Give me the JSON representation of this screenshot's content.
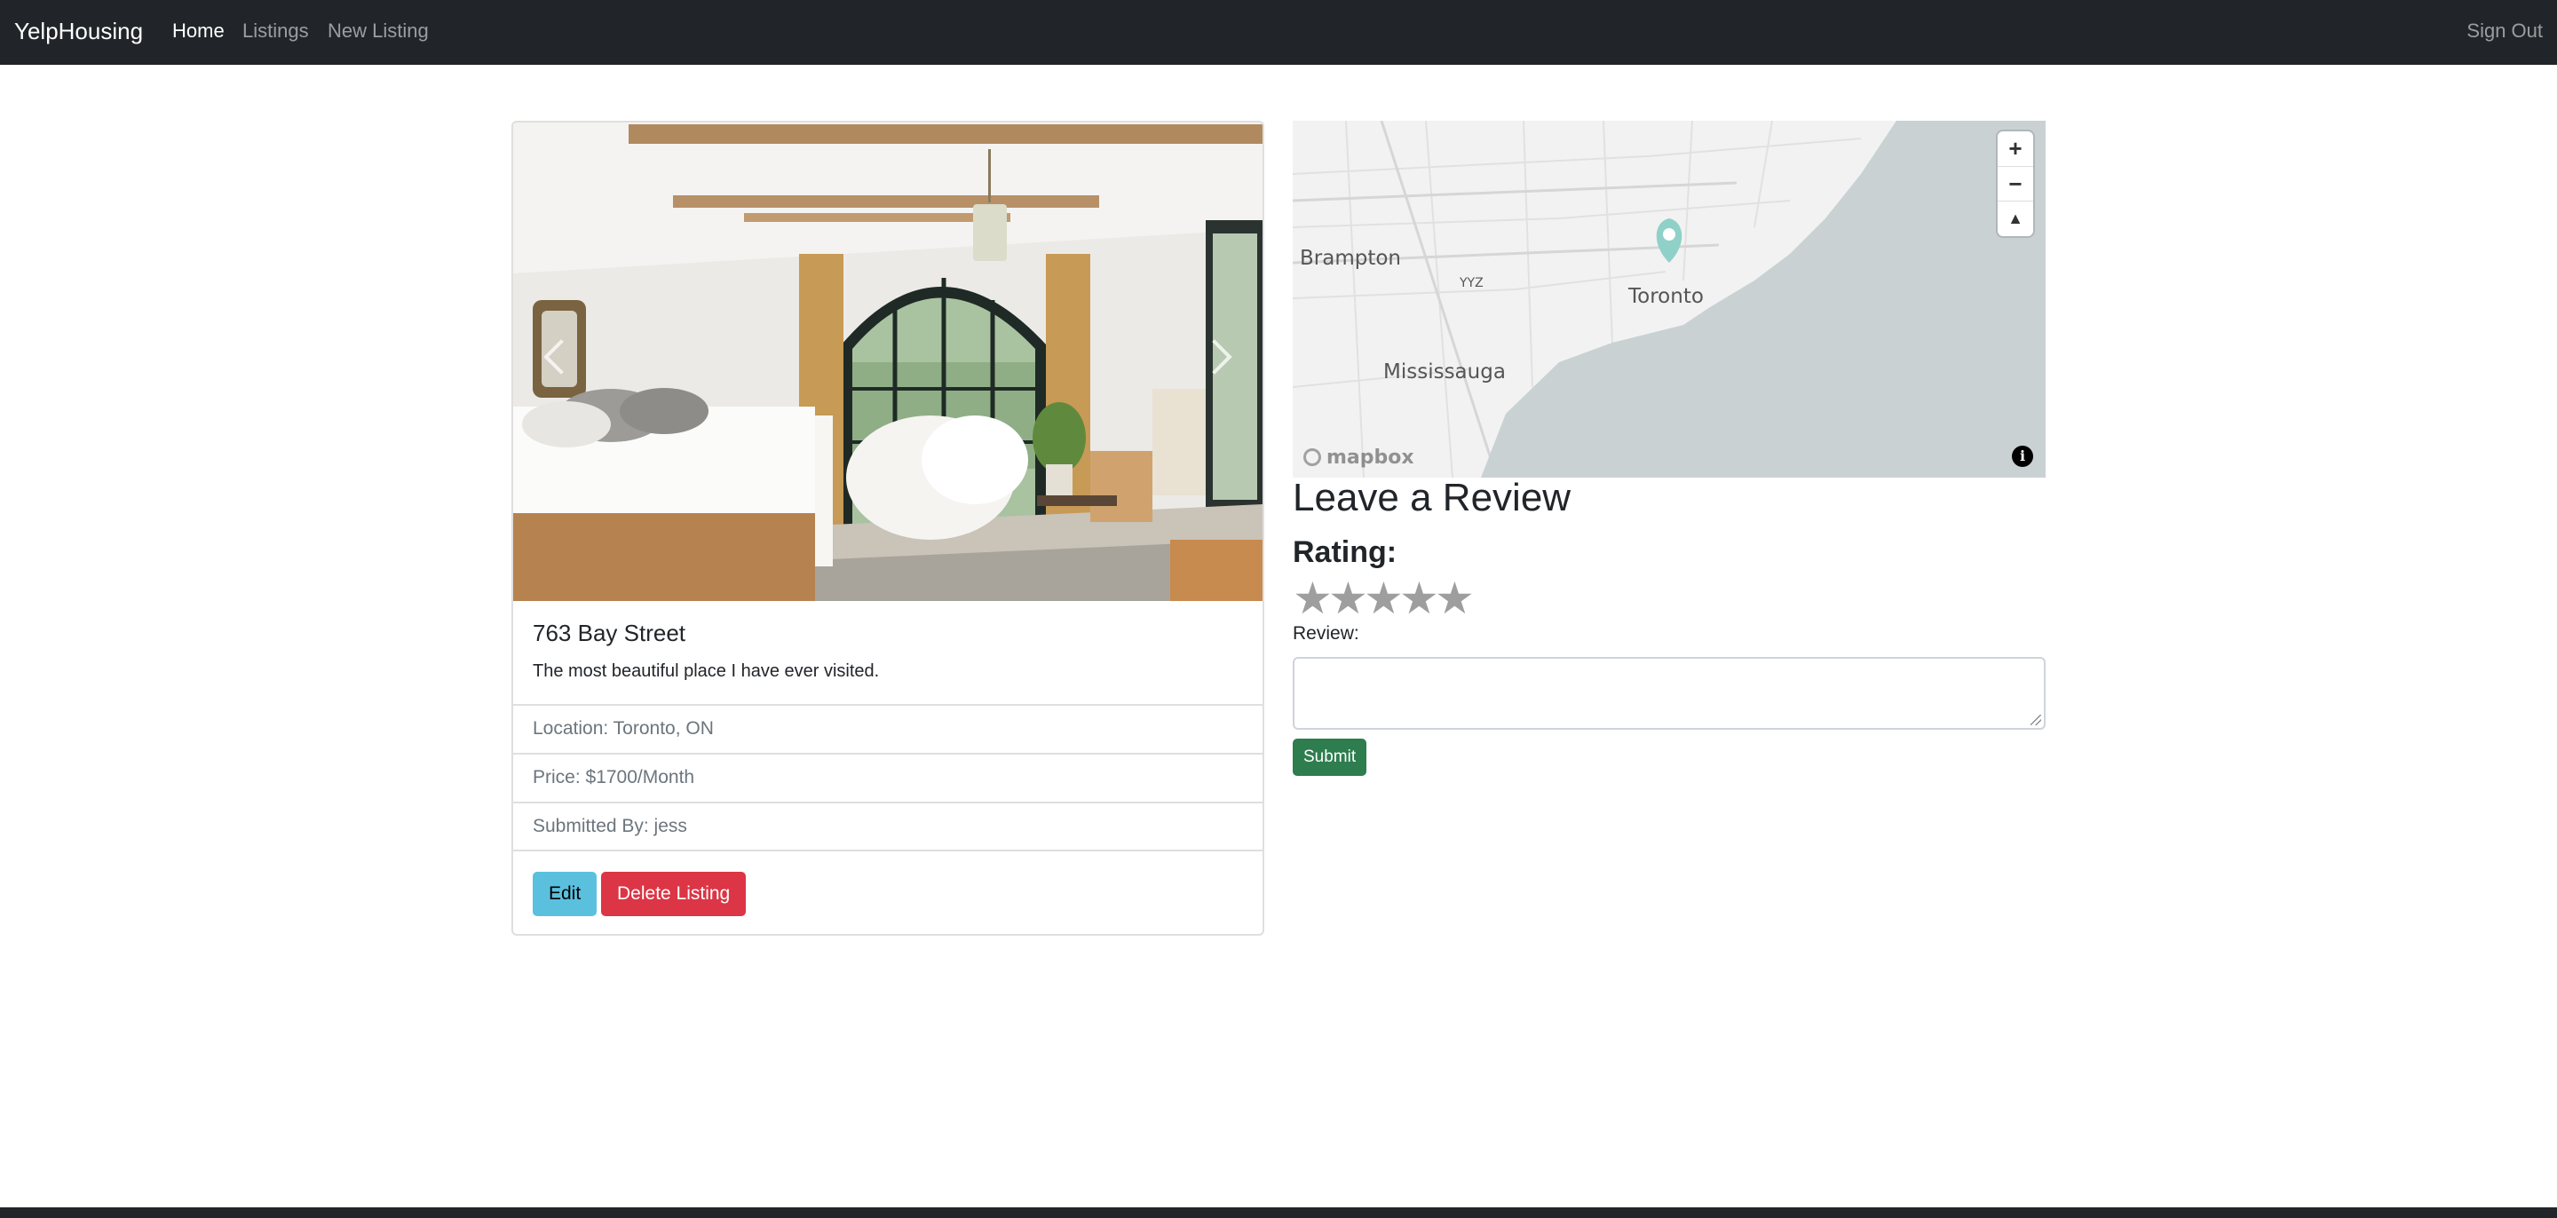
{
  "navbar": {
    "brand": "YelpHousing",
    "links": [
      {
        "label": "Home",
        "active": true
      },
      {
        "label": "Listings",
        "active": false
      },
      {
        "label": "New Listing",
        "active": false
      }
    ],
    "sign_out": "Sign Out"
  },
  "listing": {
    "title": "763 Bay Street",
    "description": "The most beautiful place I have ever visited.",
    "location": "Location: Toronto, ON",
    "price": "Price: $1700/Month",
    "submitted_by": "Submitted By: jess",
    "edit_label": "Edit",
    "delete_label": "Delete Listing"
  },
  "map": {
    "labels": {
      "brampton": "Brampton",
      "yyz": "YYZ",
      "toronto": "Toronto",
      "mississauga": "Mississauga"
    },
    "zoom_in": "+",
    "zoom_out": "−",
    "compass": "▲",
    "attribution": "i",
    "logo": "mapbox",
    "colors": {
      "water": "#c9d1d3",
      "land": "#f2f2f2",
      "marker": "#8fd1c8"
    }
  },
  "review": {
    "heading": "Leave a Review",
    "rating_label": "Rating:",
    "stars": [
      "★",
      "★",
      "★",
      "★",
      "★"
    ],
    "review_label": "Review:",
    "submit_label": "Submit"
  },
  "colors": {
    "navbar": "#212529",
    "edit_button": "#5bc0de",
    "delete_button": "#dc3545",
    "submit_button": "#2e7d4f"
  }
}
